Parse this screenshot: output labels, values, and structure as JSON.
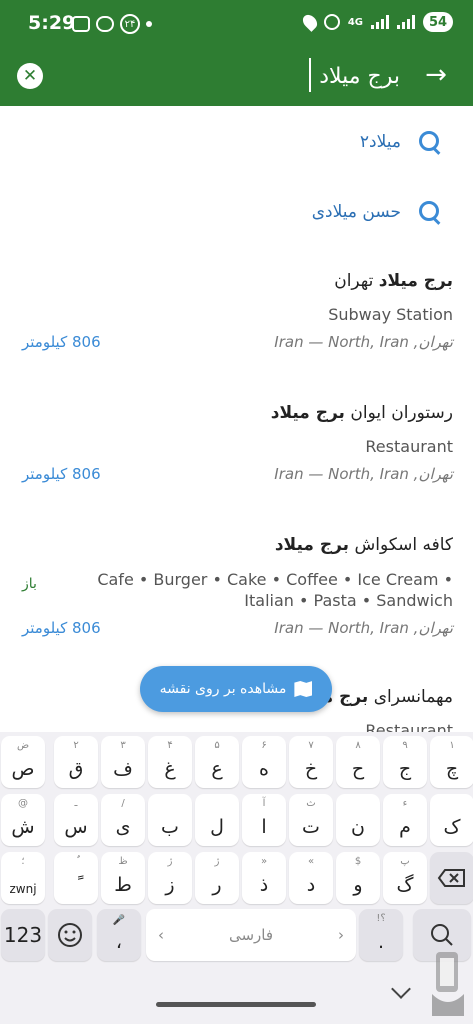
{
  "status_bar": {
    "time": "5:29",
    "notif_badge": "۲۴",
    "network": "4G",
    "battery": "54"
  },
  "search": {
    "query": "برج میلاد",
    "close_icon": "close-icon",
    "submit_icon": "arrow-right-icon"
  },
  "suggestions": [
    {
      "text": "میلاد۲"
    },
    {
      "text": "حسن میلادی"
    }
  ],
  "results": [
    {
      "title_plain": "",
      "title_bold": "برج میلاد",
      "title_after": " تهران",
      "category": "Subway Station",
      "address": "Iran — North, Iran ,تهران",
      "distance": "806 کیلومتر"
    },
    {
      "title_plain": "رستوران ایوان ",
      "title_bold": "برج میلاد",
      "title_after": "",
      "category": "Restaurant",
      "address": "Iran — North, Iran ,تهران",
      "distance": "806 کیلومتر"
    },
    {
      "title_plain": "کافه اسکواش ",
      "title_bold": "برج میلاد",
      "title_after": "",
      "category": "Cafe • Burger • Cake • Coffee • Ice Cream • Italian • Pasta • Sandwich",
      "address": "Iran — North, Iran ,تهران",
      "distance": "806 کیلومتر",
      "open_status": "باز"
    },
    {
      "title_plain": "مهمانسرای ",
      "title_bold": "برج میلاد",
      "title_after": "",
      "category": "Restaurant"
    }
  ],
  "map_button": {
    "label": "مشاهده بر روی نقشه",
    "icon": "map-icon"
  },
  "keyboard": {
    "row1": [
      {
        "main": "چ",
        "sub": "۱"
      },
      {
        "main": "ج",
        "sub": "۹"
      },
      {
        "main": "ح",
        "sub": "۸"
      },
      {
        "main": "خ",
        "sub": "۷"
      },
      {
        "main": "ه",
        "sub": "۶"
      },
      {
        "main": "ع",
        "sub": "۵"
      },
      {
        "main": "غ",
        "sub": "۴"
      },
      {
        "main": "ف",
        "sub": "۳"
      },
      {
        "main": "ق",
        "sub": "۲"
      },
      {
        "main": "ص",
        "sub": "ض"
      }
    ],
    "row2": [
      {
        "main": "ک",
        "sub": ""
      },
      {
        "main": "م",
        "sub": "ء"
      },
      {
        "main": "ن",
        "sub": ""
      },
      {
        "main": "ت",
        "sub": "ث"
      },
      {
        "main": "ا",
        "sub": "آ"
      },
      {
        "main": "ل",
        "sub": ""
      },
      {
        "main": "ب",
        "sub": ""
      },
      {
        "main": "ی",
        "sub": "/"
      },
      {
        "main": "س",
        "sub": "ـ"
      },
      {
        "main": "ش",
        "sub": "@"
      }
    ],
    "row3": [
      {
        "main": "گ",
        "sub": "پ"
      },
      {
        "main": "و",
        "sub": "$"
      },
      {
        "main": "د",
        "sub": "«"
      },
      {
        "main": "ذ",
        "sub": "»"
      },
      {
        "main": "ر",
        "sub": "ژ"
      },
      {
        "main": "ز",
        "sub": "ژ"
      },
      {
        "main": "ط",
        "sub": "ظ"
      },
      {
        "main": "ً",
        "sub": "ٌ"
      },
      {
        "main": "zwnj",
        "sub": "؛"
      }
    ],
    "num_key": "123",
    "space_label": "فارسی",
    "comma_key": "،",
    "period_key": ".",
    "period_sub": "!؟"
  }
}
